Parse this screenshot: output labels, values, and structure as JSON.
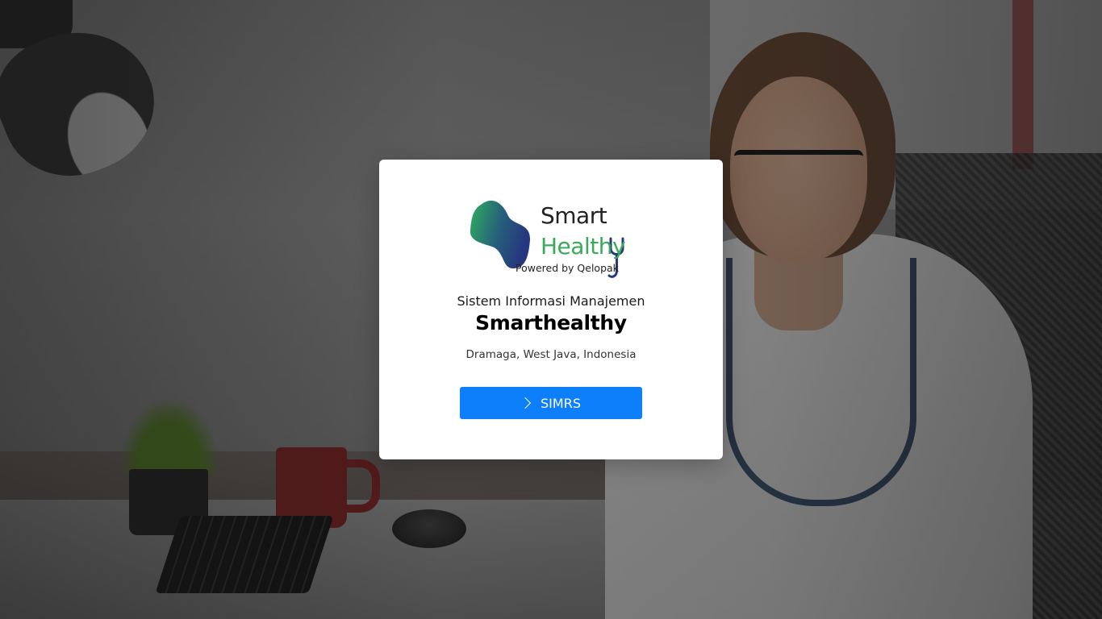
{
  "logo": {
    "word1": "Smart",
    "word2": "Healthy",
    "tagline": "Powered by Qelopak",
    "colors": {
      "mark_start": "#2fae5e",
      "mark_end": "#26377f",
      "healthy_text": "#3aaa5a"
    }
  },
  "card": {
    "subtitle": "Sistem Informasi Manajemen",
    "title": "Smarthealthy",
    "location": "Dramaga, West Java, Indonesia"
  },
  "button": {
    "label": "SIMRS",
    "icon": "chevron-right-icon",
    "color": "#0d7ffb"
  }
}
